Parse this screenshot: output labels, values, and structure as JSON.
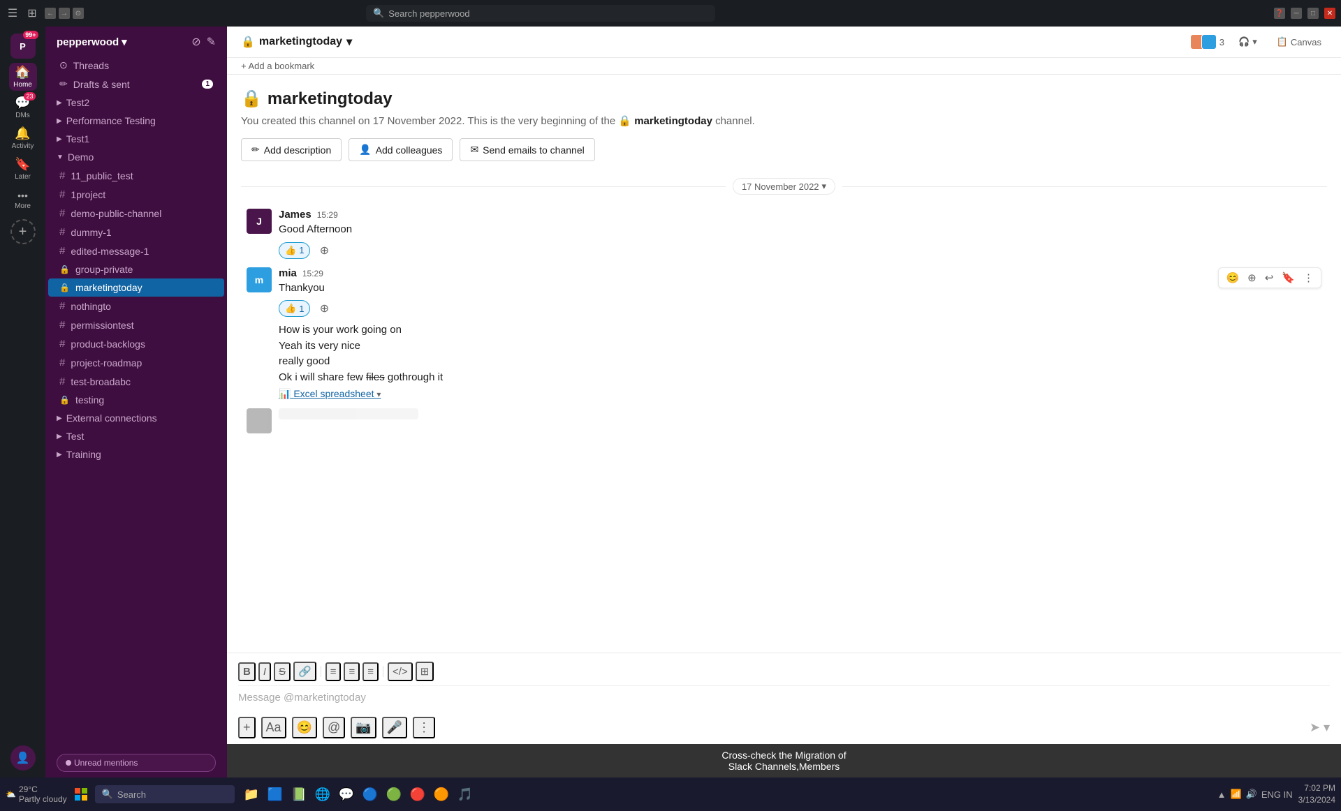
{
  "titlebar": {
    "search_placeholder": "Search pepperwood",
    "search_icon": "🔍",
    "back_icon": "←",
    "forward_icon": "→",
    "history_icon": "🕐"
  },
  "iconbar": {
    "workspace_initial": "P",
    "workspace_badge": "99+",
    "items": [
      {
        "id": "home",
        "icon": "🏠",
        "label": "Home",
        "active": true
      },
      {
        "id": "dms",
        "icon": "💬",
        "label": "DMs",
        "badge": "23"
      },
      {
        "id": "activity",
        "icon": "🔔",
        "label": "Activity"
      },
      {
        "id": "later",
        "icon": "🔖",
        "label": "Later"
      },
      {
        "id": "more",
        "icon": "···",
        "label": "More"
      }
    ],
    "add_label": "+"
  },
  "sidebar": {
    "workspace_name": "pepperwood",
    "workspace_chevron": "▾",
    "items": [
      {
        "id": "threads",
        "label": "Threads",
        "type": "special",
        "icon": "⊙"
      },
      {
        "id": "drafts",
        "label": "Drafts & sent",
        "type": "special",
        "icon": "✏",
        "badge": "1"
      },
      {
        "id": "test2",
        "label": "Test2",
        "type": "group",
        "prefix": "▶"
      },
      {
        "id": "performance-testing",
        "label": "Performance Testing",
        "type": "group",
        "prefix": "▶"
      },
      {
        "id": "test1",
        "label": "Test1",
        "type": "group",
        "prefix": "▶"
      },
      {
        "id": "demo",
        "label": "Demo",
        "type": "group",
        "prefix": "▼"
      },
      {
        "id": "11_public_test",
        "label": "11_public_test",
        "type": "channel",
        "prefix": "#"
      },
      {
        "id": "1project",
        "label": "1project",
        "type": "channel",
        "prefix": "#"
      },
      {
        "id": "demo-public-channel",
        "label": "demo-public-channel",
        "type": "channel",
        "prefix": "#"
      },
      {
        "id": "dummy-1",
        "label": "dummy-1",
        "type": "channel",
        "prefix": "#"
      },
      {
        "id": "edited-message-1",
        "label": "edited-message-1",
        "type": "channel",
        "prefix": "#"
      },
      {
        "id": "group-private",
        "label": "group-private",
        "type": "channel-private",
        "prefix": "🔒"
      },
      {
        "id": "marketingtoday",
        "label": "marketingtoday",
        "type": "channel-private",
        "prefix": "🔒",
        "active": true
      },
      {
        "id": "nothingto",
        "label": "nothingto",
        "type": "channel",
        "prefix": "#"
      },
      {
        "id": "permissiontest",
        "label": "permissiontest",
        "type": "channel",
        "prefix": "#"
      },
      {
        "id": "product-backlogs",
        "label": "product-backlogs",
        "type": "channel",
        "prefix": "#"
      },
      {
        "id": "project-roadmap",
        "label": "project-roadmap",
        "type": "channel",
        "prefix": "#"
      },
      {
        "id": "test-broadabc",
        "label": "test-broadabc",
        "type": "channel",
        "prefix": "#"
      },
      {
        "id": "testing",
        "label": "testing",
        "type": "channel",
        "prefix": "#"
      },
      {
        "id": "external-connections",
        "label": "External connections",
        "type": "group",
        "prefix": "▶"
      },
      {
        "id": "test-group",
        "label": "Test",
        "type": "group",
        "prefix": "▶"
      },
      {
        "id": "training",
        "label": "Training",
        "type": "group",
        "prefix": "▶"
      }
    ],
    "unread_mentions_label": "Unread mentions",
    "unread_mentions_icon": "↓"
  },
  "channel": {
    "name": "marketingtoday",
    "lock_icon": "🔒",
    "chevron": "▾",
    "members_count": "3",
    "headphone_icon": "🎧",
    "canvas_label": "Canvas",
    "canvas_icon": "📋",
    "bookmark_label": "+ Add a bookmark",
    "intro_title": "marketingtoday",
    "intro_lock": "🔒",
    "intro_desc_prefix": "You created this channel on 17 November 2022. This is the very beginning of the",
    "intro_channel_ref": "marketingtoday",
    "intro_desc_suffix": "channel.",
    "add_description_label": "Add description",
    "add_colleagues_label": "Add colleagues",
    "send_emails_label": "Send emails to channel",
    "date_divider": "17 November 2022",
    "messages": [
      {
        "id": "msg1",
        "author": "James",
        "time": "15:29",
        "text": "Good Afternoon",
        "avatar_initial": "J",
        "avatar_color": "#4a154b",
        "reactions": [
          {
            "emoji": "👍",
            "count": "1",
            "active": true
          }
        ]
      },
      {
        "id": "msg2",
        "author": "mia",
        "time": "15:29",
        "text": "Thankyou",
        "avatar_initial": "m",
        "avatar_color": "#2d9ee0",
        "reactions": [
          {
            "emoji": "👍",
            "count": "1",
            "active": true
          }
        ],
        "continuation": [
          "How is your work going on",
          "Yeah its very nice",
          "really good",
          "Ok i will share few files gothrough it"
        ],
        "attachment": "Excel spreadsheet"
      }
    ],
    "message_actions": [
      "😊",
      "➕",
      "↩",
      "🔖",
      "⋮"
    ],
    "composer_placeholder": "Message @marketingtoday",
    "composer_toolbar": [
      "B",
      "I",
      "S",
      "🔗",
      "≡",
      "≡",
      "≡",
      "|",
      "</>",
      "☐"
    ],
    "composer_bottom": [
      "+",
      "Aa",
      "😊",
      "@",
      "📷",
      "🎤",
      "⋮"
    ]
  },
  "bottom_bar": {
    "line1": "Cross-check the Migration of",
    "line2": "Slack Channels,Members"
  },
  "taskbar": {
    "search_label": "Search",
    "time": "7:02 PM",
    "date": "3/13/2024",
    "lang": "ENG IN",
    "weather_temp": "29°C",
    "weather_desc": "Partly cloudy"
  }
}
